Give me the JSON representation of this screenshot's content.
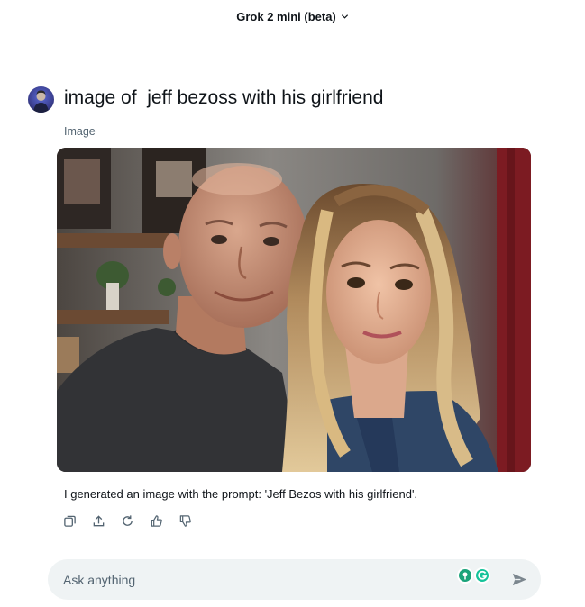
{
  "header": {
    "model_name": "Grok 2 mini (beta)"
  },
  "message": {
    "prompt": "image of  jeff bezoss with his girlfriend",
    "media_label": "Image",
    "response": "I generated an image with the prompt: 'Jeff Bezos with his girlfriend'."
  },
  "actions": [
    {
      "name": "copy-icon"
    },
    {
      "name": "share-icon"
    },
    {
      "name": "regenerate-icon"
    },
    {
      "name": "thumbs-up-icon"
    },
    {
      "name": "thumbs-down-icon"
    }
  ],
  "composer": {
    "placeholder": "Ask anything",
    "value": ""
  },
  "colors": {
    "text": "#0f1419",
    "muted": "#536471",
    "composer_bg": "#eff3f4",
    "icon": "#536471"
  }
}
